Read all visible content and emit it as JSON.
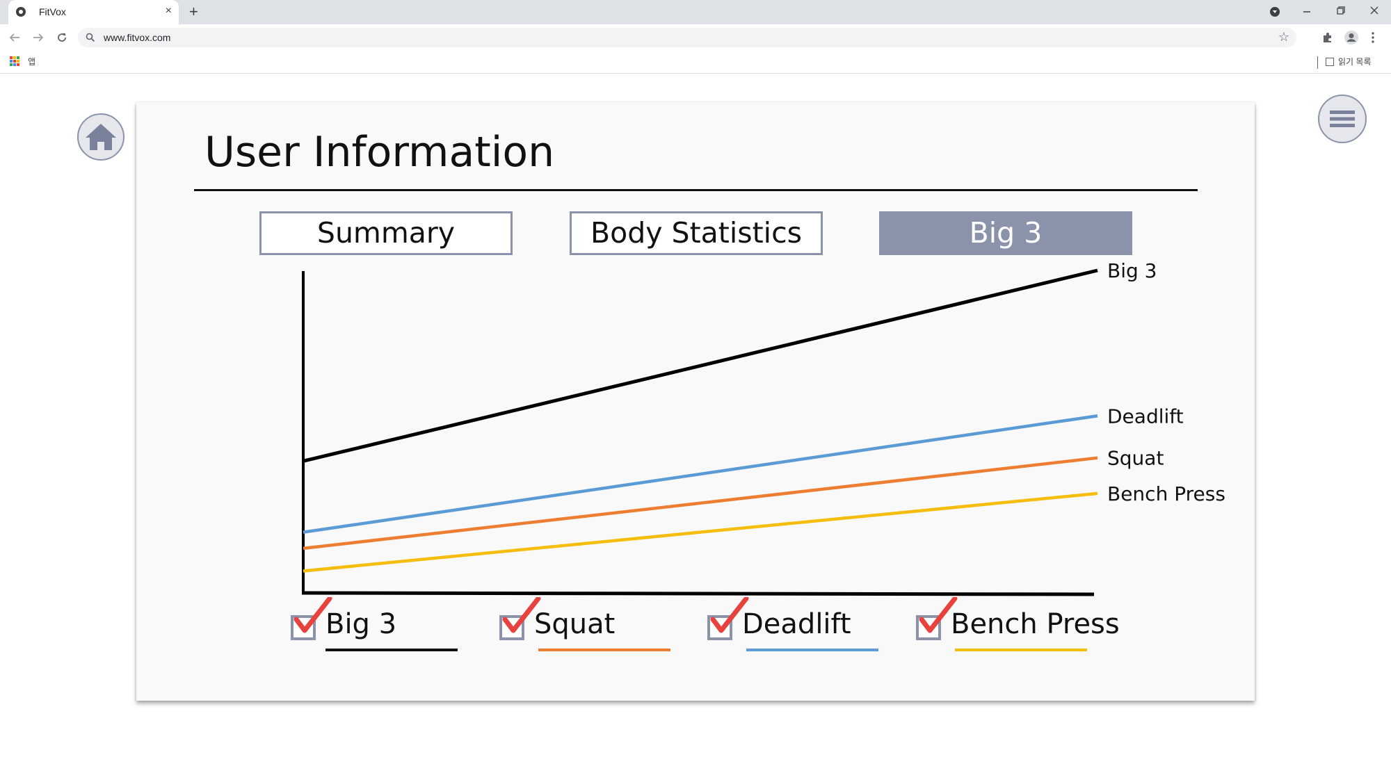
{
  "browser": {
    "tab_title": "FitVox",
    "new_tab": "+",
    "close": "×",
    "url": "www.fitvox.com",
    "apps_label": "앱",
    "reading_list": "읽기 목록"
  },
  "page": {
    "title": "User Information",
    "tabs": [
      {
        "label": "Summary",
        "active": false
      },
      {
        "label": "Body Statistics",
        "active": false
      },
      {
        "label": "Big 3",
        "active": true
      }
    ]
  },
  "chart_data": {
    "type": "line",
    "title": "",
    "xlabel": "",
    "ylabel": "",
    "x": [
      0,
      1
    ],
    "series": [
      {
        "name": "Big 3",
        "values": [
          0.41,
          1.0
        ],
        "color": "#000000"
      },
      {
        "name": "Deadlift",
        "values": [
          0.19,
          0.55
        ],
        "color": "#5b9bd5"
      },
      {
        "name": "Squat",
        "values": [
          0.14,
          0.42
        ],
        "color": "#ed7d31"
      },
      {
        "name": "Bench Press",
        "values": [
          0.07,
          0.31
        ],
        "color": "#f5bd0d"
      }
    ],
    "ylim": [
      0,
      1
    ],
    "grid": false
  },
  "legend": [
    {
      "label": "Big 3",
      "checked": true,
      "color": "#000000"
    },
    {
      "label": "Squat",
      "checked": true,
      "color": "#ed7d31"
    },
    {
      "label": "Deadlift",
      "checked": true,
      "color": "#5b9bd5"
    },
    {
      "label": "Bench Press",
      "checked": true,
      "color": "#f5bd0d"
    }
  ],
  "icons": {
    "home": "home-icon",
    "menu": "hamburger-menu-icon",
    "checkbox": "check-icon"
  }
}
